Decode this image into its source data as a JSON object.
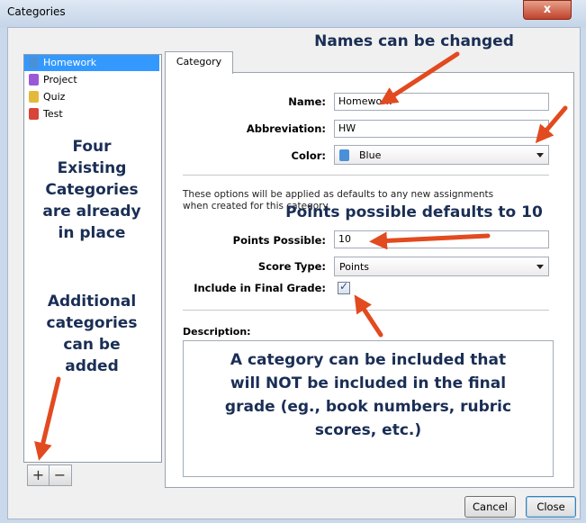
{
  "window": {
    "title": "Categories",
    "close_glyph": "x"
  },
  "categories": [
    {
      "label": "Homework",
      "color": "#4a90d9",
      "selected": true
    },
    {
      "label": "Project",
      "color": "#9b59d6",
      "selected": false
    },
    {
      "label": "Quiz",
      "color": "#e4b93a",
      "selected": false
    },
    {
      "label": "Test",
      "color": "#d9443a",
      "selected": false
    }
  ],
  "list_buttons": {
    "add": "+",
    "remove": "−"
  },
  "tab": {
    "label": "Category"
  },
  "form": {
    "name_label": "Name:",
    "name_value": "Homework",
    "abbrev_label": "Abbreviation:",
    "abbrev_value": "HW",
    "color_label": "Color:",
    "color_value": "Blue",
    "color_swatch": "#4a90d9",
    "defaults_note_line1": "These options will be applied as defaults to any new assignments",
    "defaults_note_line2": "when created for this category.",
    "points_label": "Points Possible:",
    "points_value": "10",
    "score_type_label": "Score Type:",
    "score_type_value": "Points",
    "include_label": "Include in Final Grade:",
    "include_checked": true,
    "description_label": "Description:"
  },
  "annotations": {
    "names": "Names can be changed",
    "four_line1": "Four",
    "four_line2": "Existing",
    "four_line3": "Categories",
    "four_line4": "are already",
    "four_line5": "in place",
    "add_line1": "Additional",
    "add_line2": "categories",
    "add_line3": "can be",
    "add_line4": "added",
    "points": "Points possible defaults to 10",
    "desc_line1": "A category can be included that",
    "desc_line2": "will NOT be included in the final",
    "desc_line3": "grade (eg., book numbers, rubric",
    "desc_line4": "scores, etc.)",
    "arrow_color": "#e24a1f"
  },
  "buttons": {
    "cancel": "Cancel",
    "close": "Close"
  }
}
